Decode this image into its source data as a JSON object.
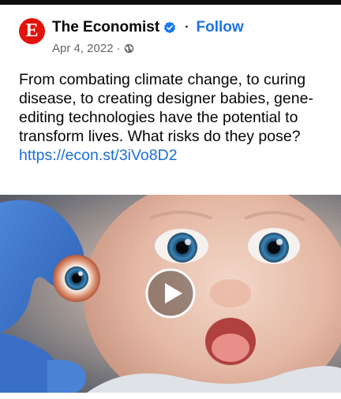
{
  "post": {
    "author": {
      "name": "The Economist",
      "avatar_letter": "E",
      "brand_color": "#e3120b",
      "verified_icon": "verified-badge-icon",
      "verified_color": "#1877f2"
    },
    "follow_label": "Follow",
    "follow_color": "#1b74e4",
    "separator": "·",
    "date": "Apr 4, 2022",
    "privacy_icon": "globe-icon",
    "caption": "From combating climate change, to curing disease, to creating designer babies, gene-editing technologies have the potential to transform lives. What risks do they pose?",
    "link": "https://econ.st/3iVo8D2",
    "link_color": "#1a6ed8",
    "media": {
      "type": "video",
      "play_icon": "play-icon"
    }
  }
}
